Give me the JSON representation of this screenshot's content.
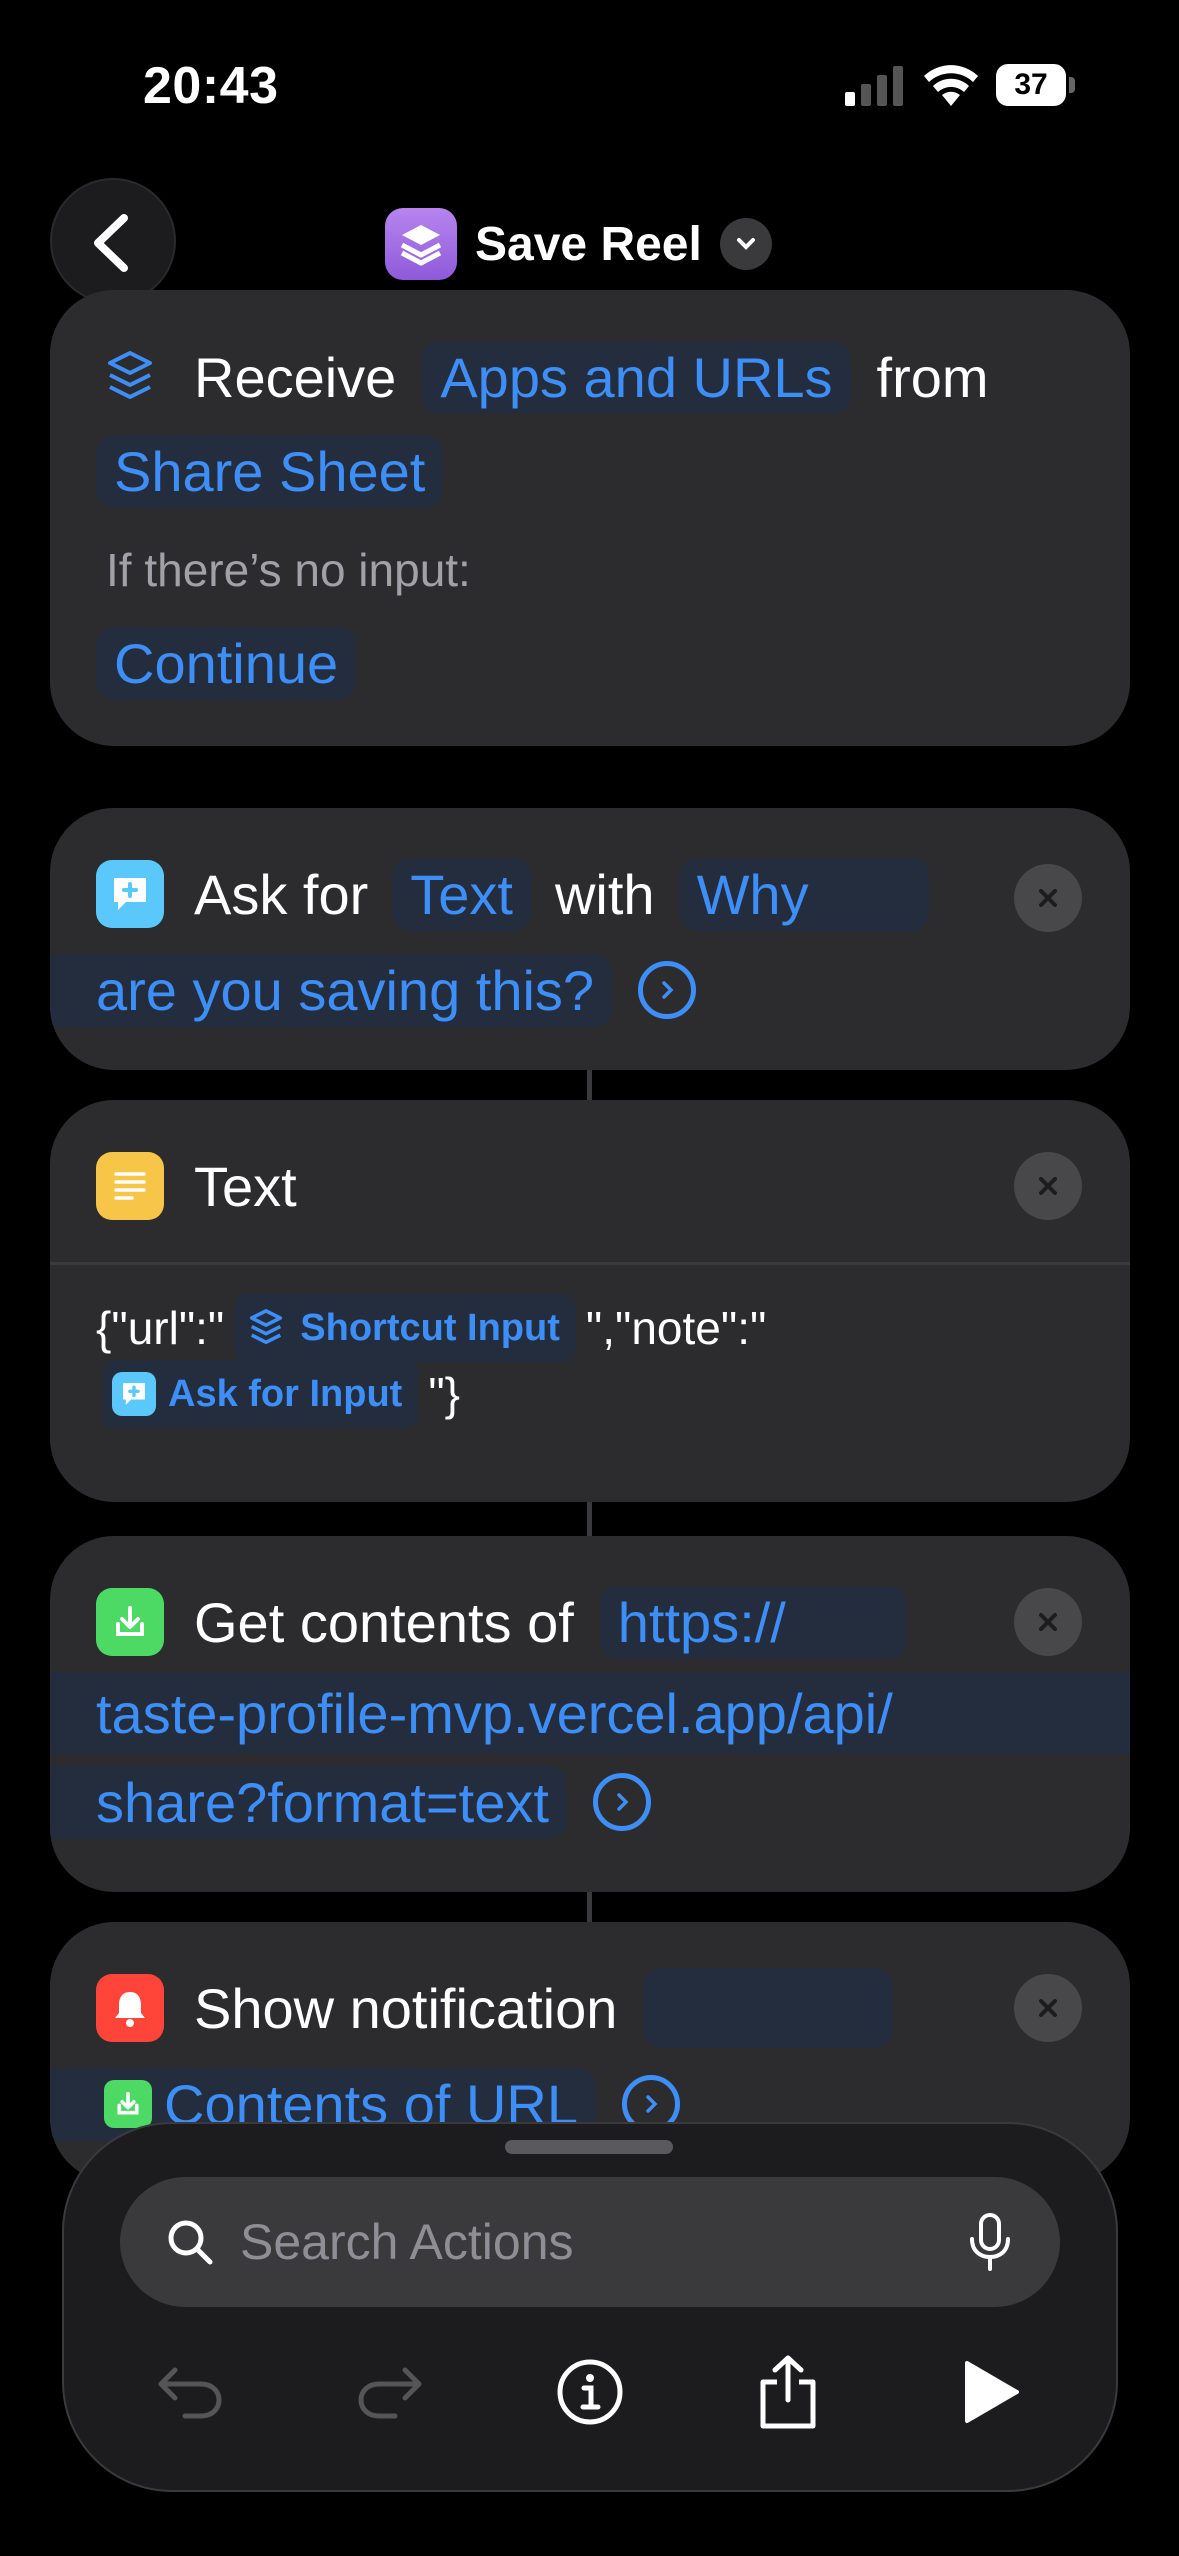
{
  "status_bar": {
    "time": "20:43",
    "battery": "37"
  },
  "nav": {
    "title": "Save Reel"
  },
  "receive_card": {
    "receive_label": "Receive",
    "input_types": "Apps and URLs",
    "from_label": "from",
    "source": "Share Sheet",
    "no_input_label": "If there’s no input:",
    "no_input_action": "Continue"
  },
  "ask_card": {
    "ask_label": "Ask for",
    "type": "Text",
    "with_label": "with",
    "prompt_line1": "Why",
    "prompt_line2": "are you saving this?"
  },
  "text_card": {
    "title": "Text",
    "prefix": "{\"url\":\"",
    "token1": "Shortcut Input",
    "middle": "\",\"note\":\"",
    "token2": "Ask for Input",
    "suffix": "\"}"
  },
  "url_card": {
    "title": "Get contents of",
    "url_line1": "https://",
    "url_line2": "taste-profile-mvp.vercel.app/api/",
    "url_line3": "share?format=text"
  },
  "notify_card": {
    "title": "Show notification",
    "token": "Contents of URL"
  },
  "bottom_sheet": {
    "search_placeholder": "Search Actions"
  },
  "colors": {
    "accent": "#3d8ef7",
    "ask_icon": "#5ac8fa",
    "text_icon": "#f7c548",
    "url_icon": "#4cd964",
    "notify_icon": "#ff453a",
    "app_icon": "#a46ee6"
  }
}
